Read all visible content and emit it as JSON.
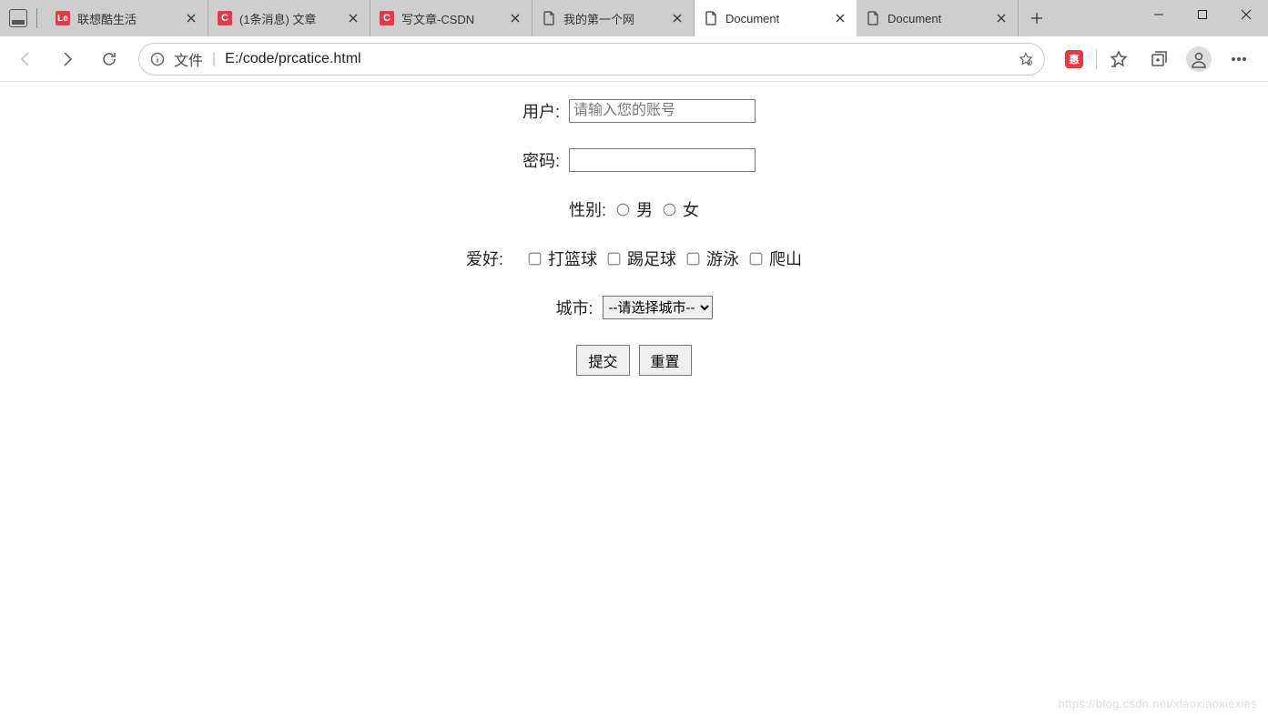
{
  "browser": {
    "tabs": [
      {
        "title": "联想酷生活",
        "favicon": "red-le"
      },
      {
        "title": "(1条消息) 文章",
        "favicon": "c"
      },
      {
        "title": "写文章-CSDN",
        "favicon": "c"
      },
      {
        "title": "我的第一个网",
        "favicon": "doc"
      },
      {
        "title": "Document",
        "favicon": "doc",
        "active": true
      },
      {
        "title": "Document",
        "favicon": "doc"
      }
    ],
    "address": {
      "scheme_label": "文件",
      "url": "E:/code/prcatice.html"
    },
    "extension_badge": "惠"
  },
  "form": {
    "user_label": "用户:",
    "user_placeholder": "请输入您的账号",
    "password_label": "密码:",
    "gender_label": "性别:",
    "gender_options": {
      "male": "男",
      "female": "女"
    },
    "hobby_label": "爱好:",
    "hobby_options": {
      "basketball": "打篮球",
      "football": "踢足球",
      "swim": "游泳",
      "climb": "爬山"
    },
    "city_label": "城市:",
    "city_placeholder_option": "--请选择城市--",
    "submit_label": "提交",
    "reset_label": "重置"
  },
  "watermark": "https://blog.csdn.net/xiaoxiaoxiexies"
}
